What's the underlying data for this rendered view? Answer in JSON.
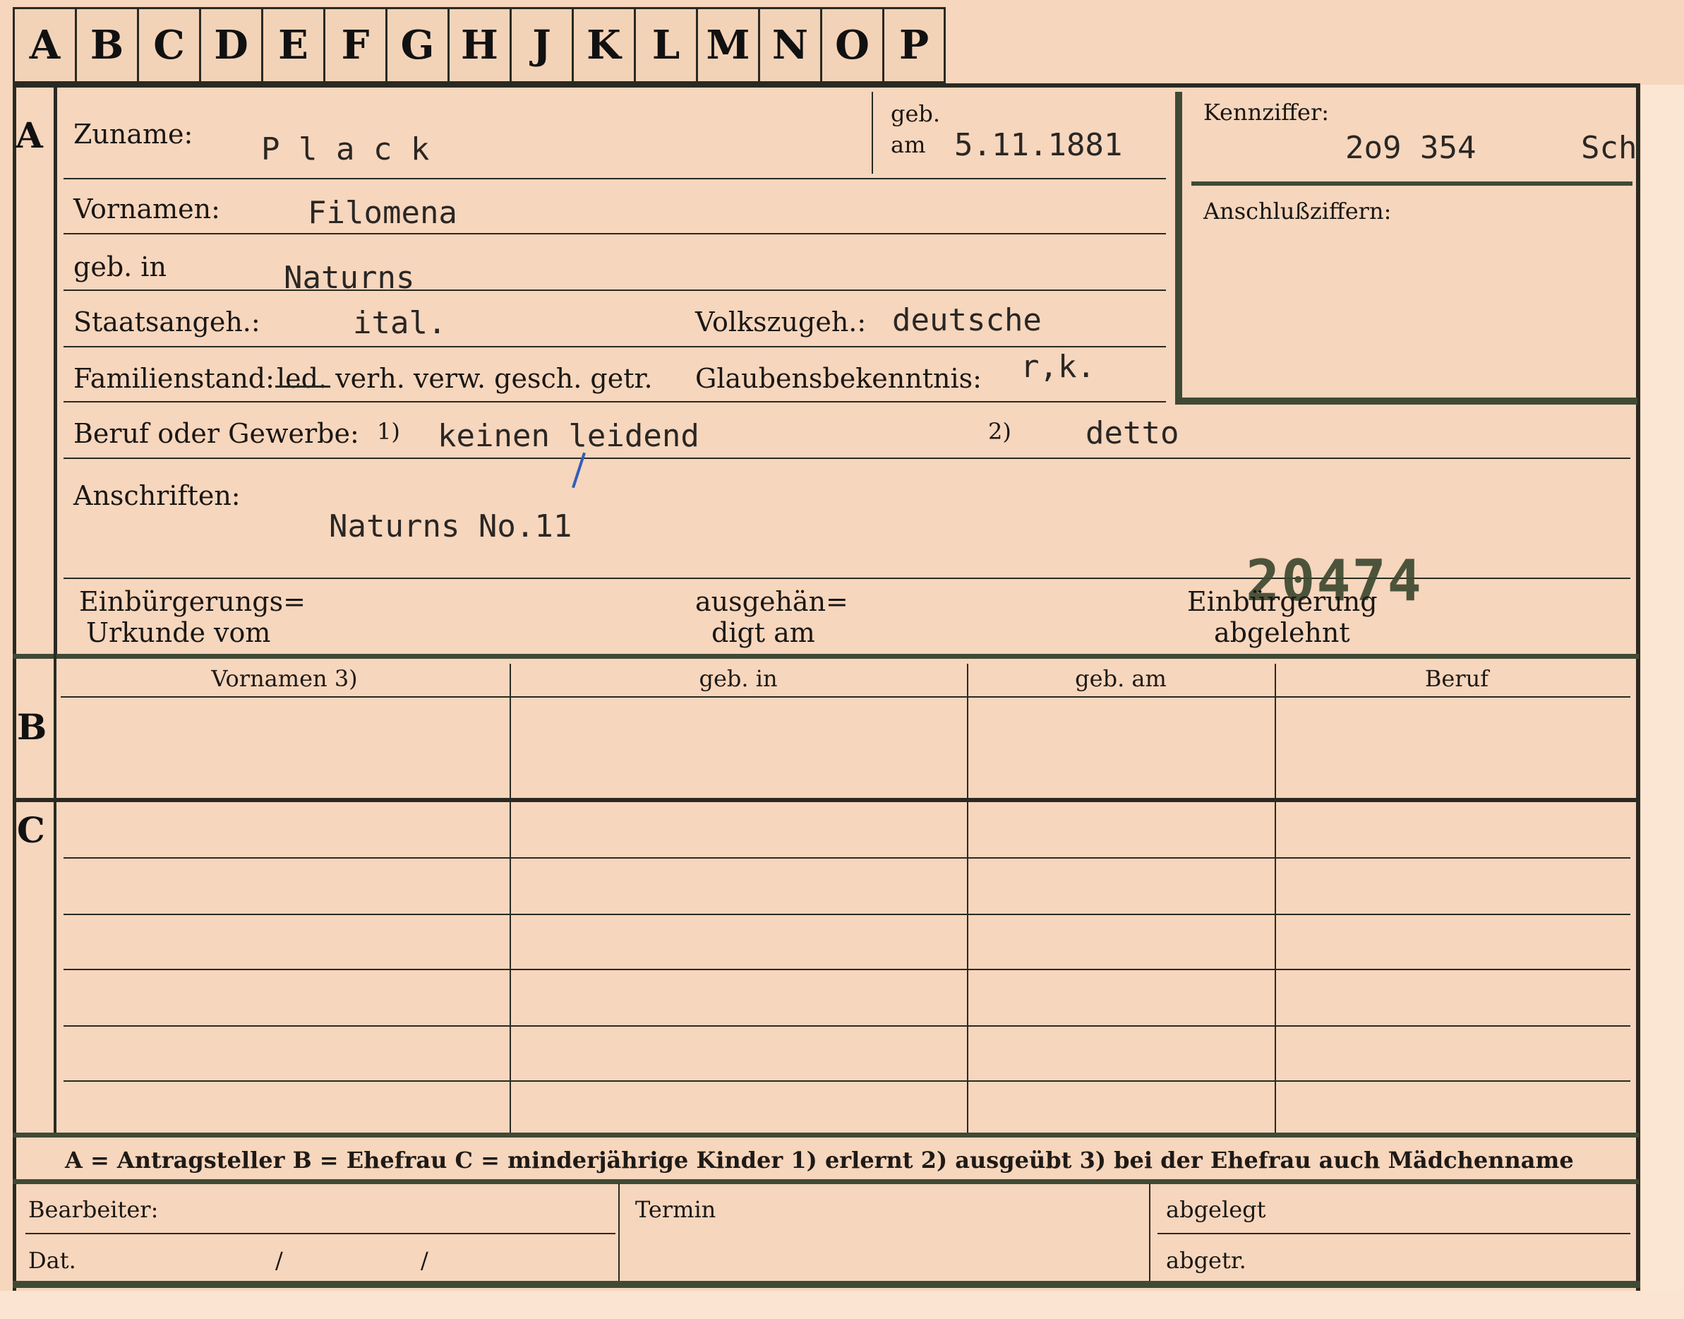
{
  "tabs": [
    "A",
    "B",
    "C",
    "D",
    "E",
    "F",
    "G",
    "H",
    "J",
    "K",
    "L",
    "M",
    "N",
    "O",
    "P"
  ],
  "sections": {
    "a": "A",
    "b": "B",
    "c": "C"
  },
  "labels": {
    "zuname": "Zuname:",
    "geb_top": "geb.",
    "geb_am": "am",
    "kennziffer": "Kennziffer:",
    "vornamen": "Vornamen:",
    "anschlussziffern": "Anschlußziffern:",
    "geb_in": "geb. in",
    "staatsangeh": "Staatsangeh.:",
    "volkszugeh": "Volkszugeh.:",
    "familienstand": "Familienstand:",
    "familienstand_options": "led. verh. verw. gesch. getr.",
    "glaubensbekenntnis": "Glaubensbekenntnis:",
    "beruf": "Beruf oder Gewerbe:",
    "fn1": "1)",
    "fn2": "2)",
    "anschriften": "Anschriften:",
    "einb_urkunde_1": "Einbürgerungs=",
    "einb_urkunde_2": "Urkunde vom",
    "ausgehaen_1": "ausgehän=",
    "ausgehaen_2": "digt am",
    "einb_abgelehnt_1": "Einbürgerung",
    "einb_abgelehnt_2": "abgelehnt"
  },
  "values": {
    "zuname": "P l a c k",
    "geb_am": "5.11.1881",
    "kennziffer": "2o9 354",
    "kennziffer_suffix": "Sch",
    "vornamen": "Filomena",
    "geb_in": "Naturns",
    "staatsangeh": "ital.",
    "volkszugeh": "deutsche",
    "glaubensbekenntnis": "r,k.",
    "beruf1": "keinen leidend",
    "beruf2": "detto",
    "anschrift": "Naturns No.11",
    "stamp": "20474"
  },
  "table": {
    "headers": [
      "Vornamen 3)",
      "geb. in",
      "geb. am",
      "Beruf"
    ]
  },
  "legend": "A = Antragsteller   B = Ehefrau   C = minderjährige Kinder   1) erlernt   2) ausgeübt   3) bei der Ehefrau auch Mädchenname",
  "footer": {
    "bearbeiter": "Bearbeiter:",
    "dat": "Dat.",
    "slash1": "/",
    "slash2": "/",
    "termin": "Termin",
    "abgelegt": "abgelegt",
    "abgetr": "abgetr."
  }
}
